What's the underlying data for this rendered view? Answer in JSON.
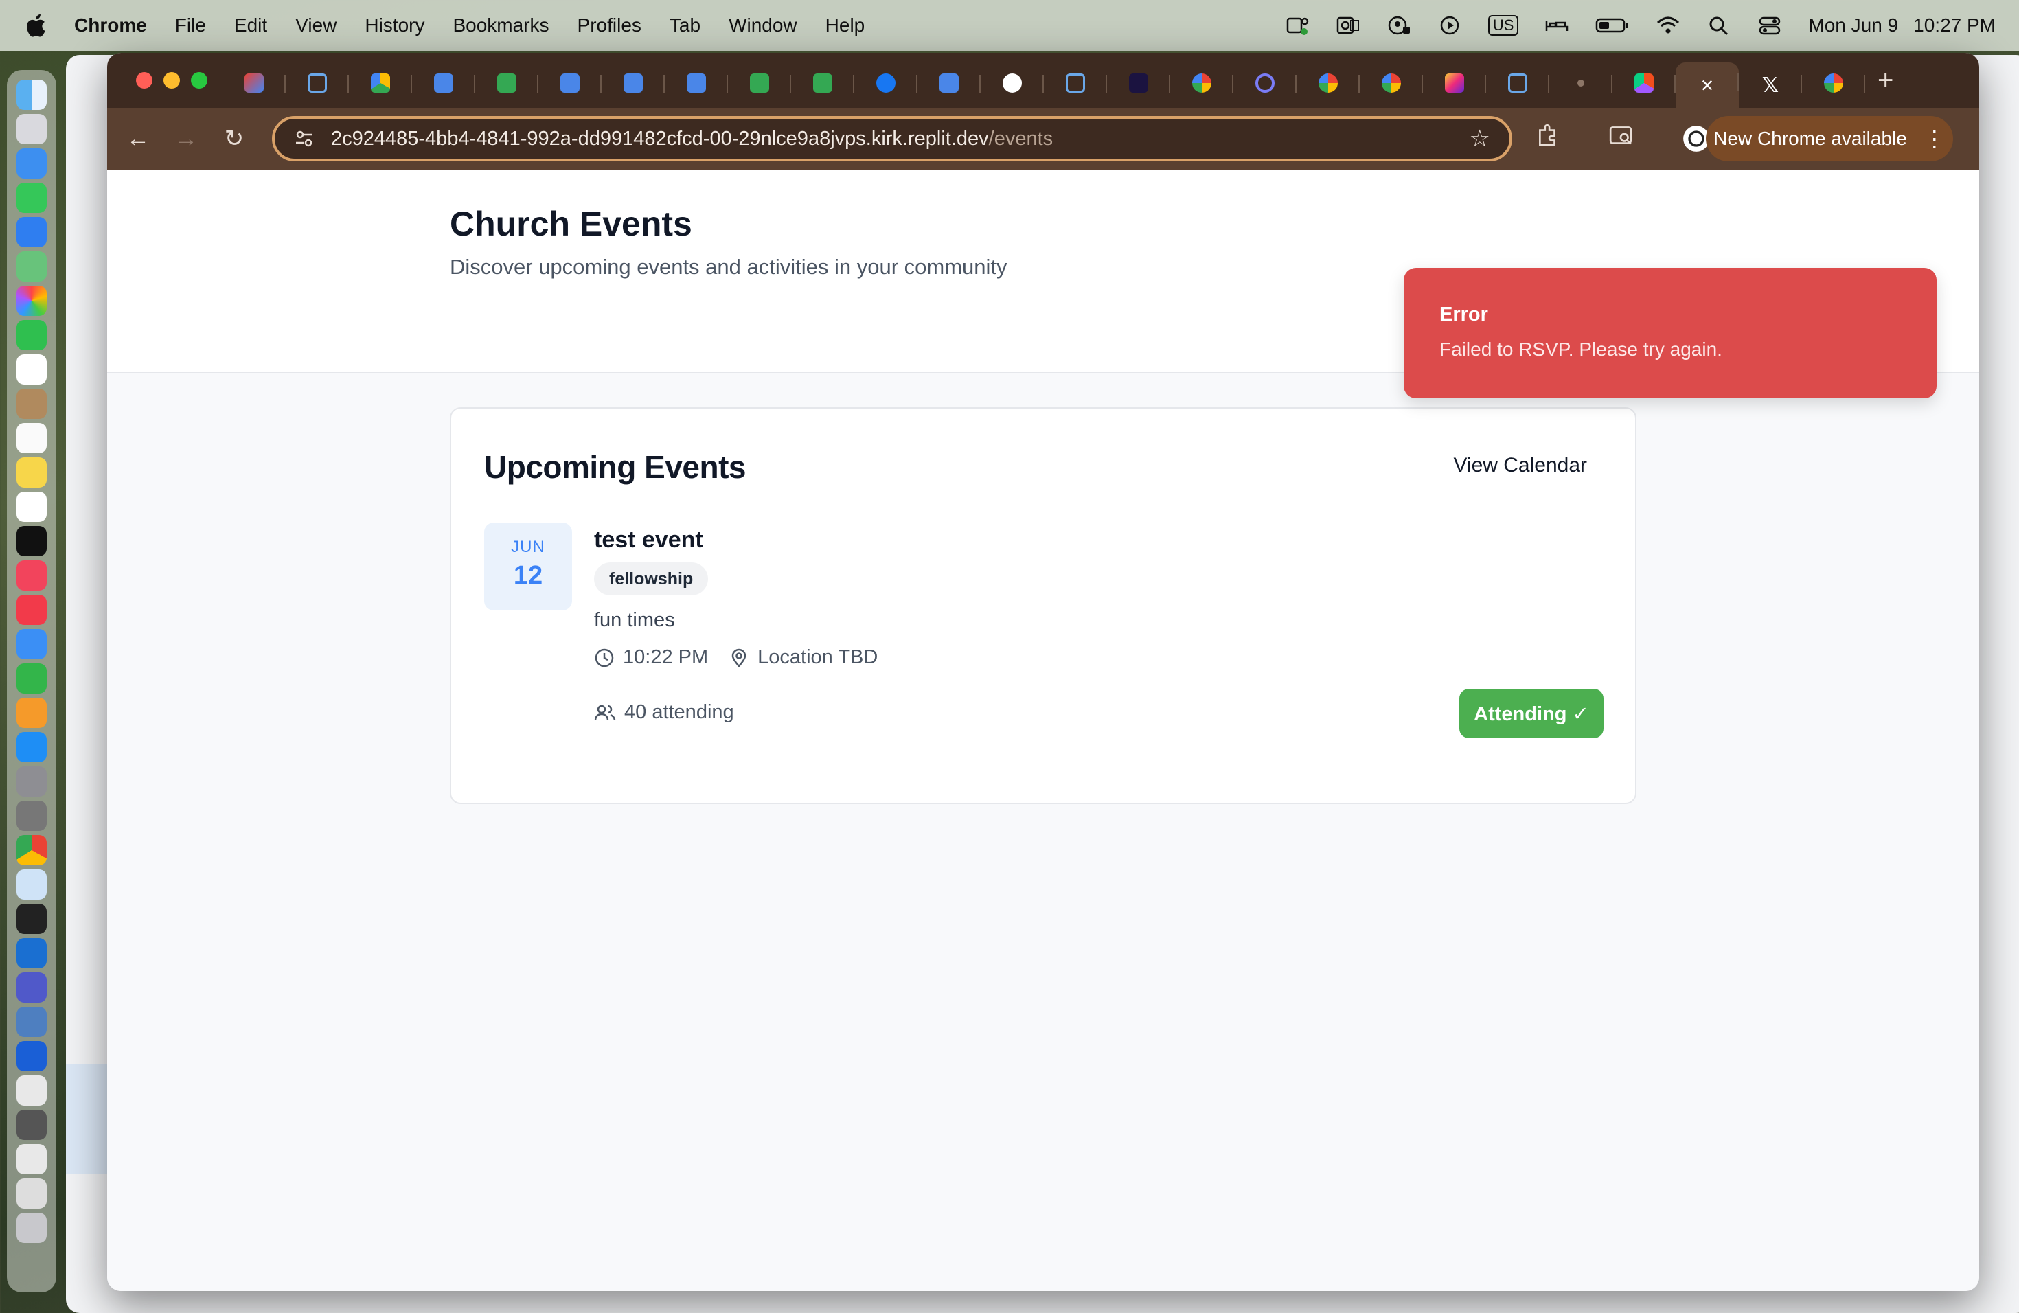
{
  "menubar": {
    "app_name": "Chrome",
    "items": [
      "File",
      "Edit",
      "View",
      "History",
      "Bookmarks",
      "Profiles",
      "Tab",
      "Window",
      "Help"
    ],
    "input_source": "US",
    "date": "Mon Jun 9",
    "time": "10:27 PM"
  },
  "browser": {
    "url_host": "2c924485-4bb4-4841-992a-dd991482cfcd-00-29nlce9a8jvps.kirk.replit.dev",
    "url_path": "/events",
    "update_label": "New Chrome available",
    "tab_favicons": [
      "gmail",
      "notion",
      "drive",
      "docs",
      "sheets",
      "docs",
      "docs",
      "docs",
      "sheets",
      "sheets",
      "facebook",
      "docs",
      "openai",
      "notion",
      "adobe",
      "google",
      "circle",
      "google",
      "google",
      "instagram",
      "notion",
      "dot",
      "figma"
    ],
    "active_tab_close": "×"
  },
  "page": {
    "title": "Church Events",
    "subtitle": "Discover upcoming events and activities in your community"
  },
  "events_card": {
    "title": "Upcoming Events",
    "view_calendar_label": "View Calendar",
    "event": {
      "month": "JUN",
      "day": "12",
      "title": "test event",
      "tag": "fellowship",
      "description": "fun times",
      "time": "10:22 PM",
      "location": "Location TBD",
      "attending_count": "40 attending",
      "rsvp_label": "Attending ✓"
    }
  },
  "toast": {
    "title": "Error",
    "message": "Failed to RSVP. Please try again.",
    "color": "#dc4b4b"
  },
  "colors": {
    "accent_blue": "#3b82f6",
    "success_green": "#4caf50",
    "chrome_frame": "#5a4030"
  }
}
